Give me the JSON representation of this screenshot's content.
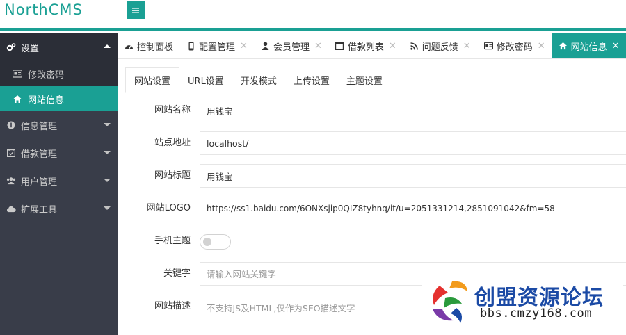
{
  "app": {
    "logo": "NorthCMS"
  },
  "sidebar": {
    "items": [
      {
        "label": "设置",
        "icon": "gears-icon"
      },
      {
        "label": "信息管理",
        "icon": "info-icon"
      },
      {
        "label": "借款管理",
        "icon": "calendar-check-icon"
      },
      {
        "label": "用户管理",
        "icon": "users-icon"
      },
      {
        "label": "扩展工具",
        "icon": "cloud-icon"
      }
    ],
    "sub_items": [
      {
        "label": "修改密码",
        "icon": "id-card-icon"
      },
      {
        "label": "网站信息",
        "icon": "home-icon"
      }
    ]
  },
  "tabs": [
    {
      "label": "控制面板",
      "icon": "dashboard-icon"
    },
    {
      "label": "配置管理",
      "icon": "mobile-icon"
    },
    {
      "label": "会员管理",
      "icon": "user-icon"
    },
    {
      "label": "借款列表",
      "icon": "calendar-icon"
    },
    {
      "label": "问题反馈",
      "icon": "rss-icon"
    },
    {
      "label": "修改密码",
      "icon": "id-card-icon"
    },
    {
      "label": "网站信息",
      "icon": "home-icon"
    }
  ],
  "close_glyph": "✕",
  "subtabs": [
    "网站设置",
    "URL设置",
    "开发模式",
    "上传设置",
    "主题设置"
  ],
  "form": {
    "site_name": {
      "label": "网站名称",
      "value": "用钱宝"
    },
    "site_url": {
      "label": "站点地址",
      "value": "localhost/"
    },
    "site_title": {
      "label": "网站标题",
      "value": "用钱宝"
    },
    "site_logo": {
      "label": "网站LOGO",
      "value": "https://ss1.baidu.com/6ONXsjip0QIZ8tyhnq/it/u=2051331214,2851091042&fm=58"
    },
    "mobile_theme": {
      "label": "手机主题",
      "enabled": false
    },
    "keywords": {
      "label": "关键字",
      "value": "",
      "placeholder": "请输入网站关键字"
    },
    "description": {
      "label": "网站描述",
      "value": "",
      "placeholder": "不支持JS及HTML,仅作为SEO描述文字"
    }
  },
  "watermark": {
    "text": "创盟资源论坛",
    "url": "bbs.cmzy168.com"
  },
  "colors": {
    "accent": "#1aa094",
    "sidebar_bg": "#393d49",
    "sidebar_open_bg": "#2b2e37"
  }
}
